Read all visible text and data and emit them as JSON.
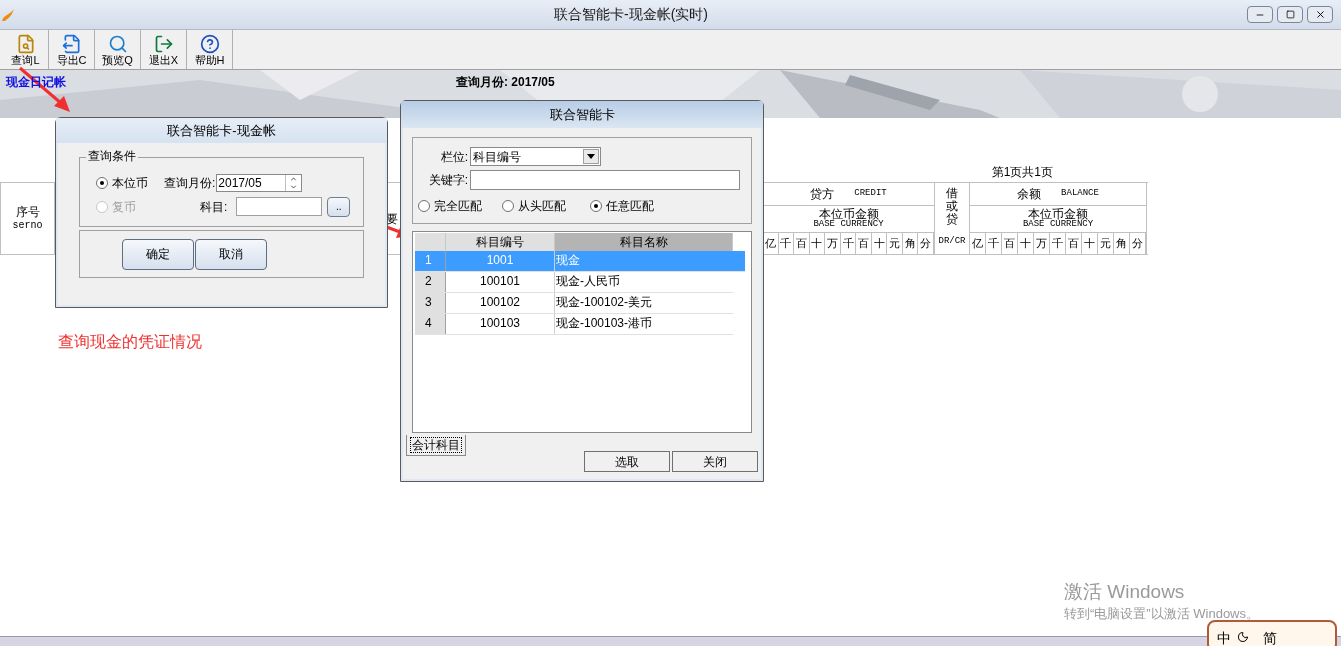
{
  "window": {
    "title": "联合智能卡-现金帐(实时)"
  },
  "toolbar": [
    {
      "label": "查询L",
      "kind": "query"
    },
    {
      "label": "导出C",
      "kind": "export"
    },
    {
      "label": "预览Q",
      "kind": "preview"
    },
    {
      "label": "退出X",
      "kind": "exit"
    },
    {
      "label": "帮助H",
      "kind": "help"
    }
  ],
  "banner": {
    "title": "现金日记帐",
    "month": "查询月份: 2017/05"
  },
  "ledger": {
    "page": "第1页共1页",
    "serial": {
      "label": "序号",
      "code": "serno"
    },
    "summary_fragment": "要",
    "credit": {
      "label": "贷方",
      "code": "CREDIT",
      "currency": "本位币金额",
      "currency_code": "BASE CURRENCY",
      "digits": [
        "亿",
        "千",
        "百",
        "十",
        "万",
        "千",
        "百",
        "十",
        "元",
        "角",
        "分"
      ]
    },
    "direction": {
      "label": "借或贷",
      "code": "DR/CR"
    },
    "balance": {
      "label": "余额",
      "code": "BALANCE",
      "currency": "本位币金额",
      "currency_code": "BASE CURRENCY",
      "digits": [
        "亿",
        "千",
        "百",
        "十",
        "万",
        "千",
        "百",
        "十",
        "元",
        "角",
        "分"
      ]
    }
  },
  "query_dialog": {
    "title": "联合智能卡-现金帐",
    "group": "查询条件",
    "currencies": [
      {
        "label": "本位币",
        "selected": true,
        "disabled": false
      },
      {
        "label": "复币",
        "selected": false,
        "disabled": true
      }
    ],
    "month_label": "查询月份:",
    "month": "2017/05",
    "account_label": "科目:",
    "browse": "..",
    "buttons": [
      "确定",
      "取消"
    ]
  },
  "lookup_dialog": {
    "title": "联合智能卡",
    "field_label": "栏位:",
    "field": "科目编号",
    "keyword_label": "关键字:",
    "matches": [
      {
        "label": "完全匹配",
        "selected": false
      },
      {
        "label": "从头匹配",
        "selected": false
      },
      {
        "label": "任意匹配",
        "selected": true
      }
    ],
    "columns": [
      {
        "label": "科目编号",
        "sorted": false
      },
      {
        "label": "科目名称",
        "sorted": true
      }
    ],
    "rows": [
      {
        "index": "1",
        "code": "1001",
        "name": "现金",
        "selected": true
      },
      {
        "index": "2",
        "code": "100101",
        "name": "现金-人民币",
        "selected": false
      },
      {
        "index": "3",
        "code": "100102",
        "name": "现金-100102-美元",
        "selected": false
      },
      {
        "index": "4",
        "code": "100103",
        "name": "现金-100103-港币",
        "selected": false
      }
    ],
    "tab": "会计科目",
    "buttons": [
      "选取",
      "关闭"
    ]
  },
  "annotation": "查询现金的凭证情况",
  "activation": {
    "title": "激活 Windows",
    "hint": "转到“电脑设置”以激活 Windows。"
  },
  "ime": {
    "mode": "中",
    "script": "简"
  }
}
